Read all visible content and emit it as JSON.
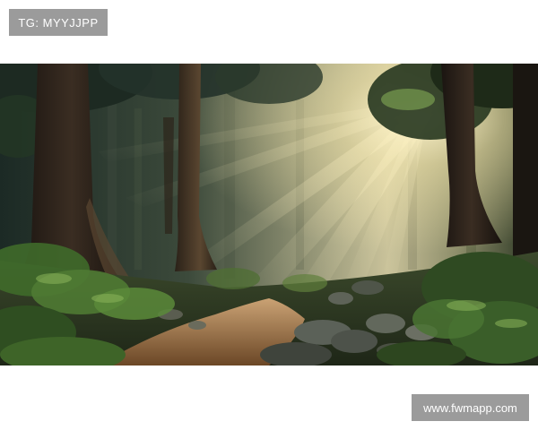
{
  "top_badge": {
    "text": "TG: MYYJJPP"
  },
  "bottom_badge": {
    "text": "www.fwmapp.com"
  },
  "photo": {
    "subject": "forest",
    "colors": {
      "sky_glow": "#f4ecc6",
      "canopy_dark": "#1f2c22",
      "fern_green": "#4f7a33",
      "path_soil": "#9a6a3f",
      "rock_gray": "#5b6158"
    }
  }
}
